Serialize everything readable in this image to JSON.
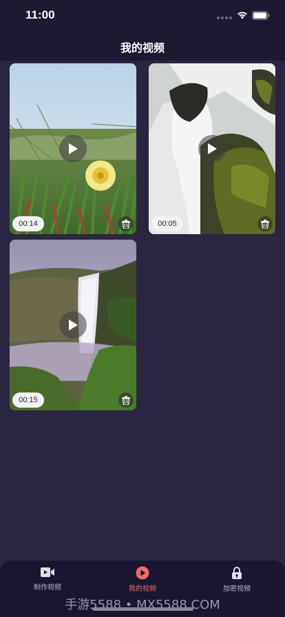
{
  "status_bar": {
    "time": "11:00"
  },
  "nav": {
    "title": "我的视频"
  },
  "videos": [
    {
      "duration": "00:14",
      "theme": "flower"
    },
    {
      "duration": "00:05",
      "theme": "waterfall-rocks"
    },
    {
      "duration": "00:15",
      "theme": "waterfall-cliff"
    }
  ],
  "tab_bar": {
    "tabs": [
      {
        "label": "制作视频",
        "icon": "video-camera-icon",
        "active": false
      },
      {
        "label": "我的视频",
        "icon": "play-circle-icon",
        "active": true
      },
      {
        "label": "加密视频",
        "icon": "lock-icon",
        "active": false
      }
    ]
  },
  "watermark": "手游5588 • MX5588.COM",
  "colors": {
    "accent": "#f06a6a",
    "background": "#2a2540",
    "bar": "#1d1930"
  }
}
